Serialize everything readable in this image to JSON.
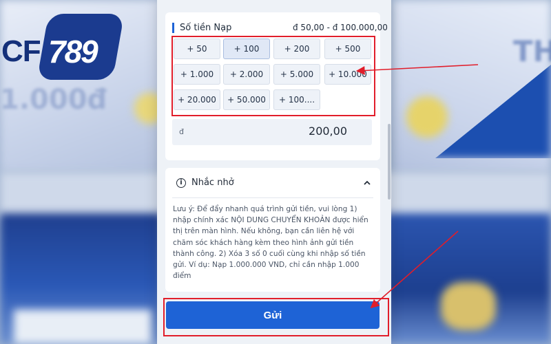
{
  "logo": {
    "text_a": "CF",
    "text_b": "789"
  },
  "background": {
    "ghost_amount": "1.000đ",
    "ghost_th": "TH"
  },
  "amount": {
    "title": "Số tiền Nạp",
    "range": "đ 50,00 - đ 100.000,00",
    "chips": [
      "+ 50",
      "+ 100",
      "+ 200",
      "+ 500",
      "+ 1.000",
      "+ 2.000",
      "+ 5.000",
      "+ 10.000",
      "+ 20.000",
      "+ 50.000",
      "+ 100...."
    ],
    "currency": "đ",
    "value": "200,00"
  },
  "note": {
    "header": "Nhắc nhở",
    "text": "Lưu ý: Để đẩy nhanh quá trình gửi tiền, vui lòng 1) nhập chính xác NỘI DUNG CHUYỂN KHOẢN được hiển thị trên màn hình. Nếu không, bạn cần liên hệ với chăm sóc khách hàng kèm theo hình ảnh gửi tiền thành công. 2) Xóa 3 số 0 cuối cùng khi nhập số tiền gửi. Ví dụ: Nạp 1.000.000 VND, chỉ cần nhập 1.000 điểm"
  },
  "submit": {
    "label": "Gửi"
  },
  "colors": {
    "accent": "#1e63d6",
    "highlight": "#e11d2a"
  },
  "icons": {
    "info": "info-icon",
    "collapse": "chevron-up-icon"
  }
}
